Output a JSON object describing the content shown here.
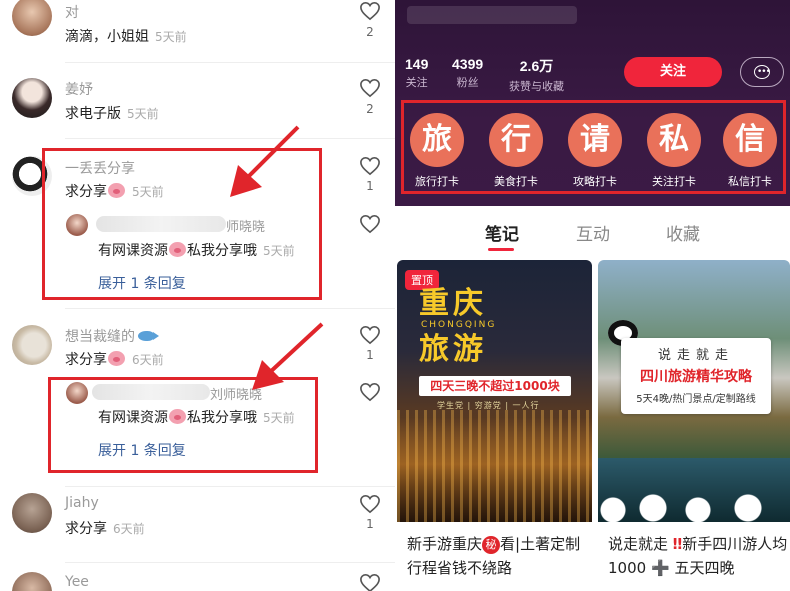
{
  "comments": [
    {
      "user": "对",
      "text": "滴滴，小姐姐",
      "time": "5天前",
      "likes": "2"
    },
    {
      "user": "姜妤",
      "text": "求电子版",
      "time": "5天前",
      "likes": "2"
    },
    {
      "user": "一丢丢分享",
      "text": "求分享",
      "time": "5天前",
      "likes": "1",
      "reply": {
        "name": "师晓晓",
        "text_a": "有网课资源",
        "text_b": "私我分享哦",
        "time": "5天前"
      },
      "expand": "展开 1 条回复"
    },
    {
      "user": "想当裁缝的",
      "text": "求分享",
      "time": "6天前",
      "likes": "1",
      "reply": {
        "name": "刘师晓晓",
        "text_a": "有网课资源",
        "text_b": "私我分享哦",
        "time": "5天前"
      },
      "expand": "展开 1 条回复"
    },
    {
      "user": "Jiahy",
      "text": "求分享",
      "time": "6天前",
      "likes": "1"
    },
    {
      "user": "Yee"
    }
  ],
  "profile": {
    "stats": [
      {
        "num": "149",
        "label": "关注"
      },
      {
        "num": "4399",
        "label": "粉丝"
      },
      {
        "num": "2.6万",
        "label": "获赞与收藏"
      }
    ],
    "follow_label": "关注",
    "categories": [
      {
        "char": "旅",
        "label": "旅行打卡"
      },
      {
        "char": "行",
        "label": "美食打卡"
      },
      {
        "char": "请",
        "label": "攻略打卡"
      },
      {
        "char": "私",
        "label": "关注打卡"
      },
      {
        "char": "信",
        "label": "私信打卡"
      }
    ],
    "tabs": [
      "笔记",
      "互动",
      "收藏"
    ]
  },
  "notes": [
    {
      "pin": "置顶",
      "cover_title_1": "重庆",
      "cover_title_2": "旅游",
      "cover_sub": "CHONGQING",
      "cover_banner": "四天三晚不超过1000块",
      "cover_mini": "学生党 | 穷游党 | 一人行",
      "title_a": "新手游重庆",
      "title_secret": "秘",
      "title_b": "看|土著定制行程省钱不绕路"
    },
    {
      "cover_t1": "说走就走",
      "cover_t2": "四川旅游精华攻略",
      "cover_t3": "5天4晚/热门景点/定制路线",
      "title_a": "说走就走",
      "title_bang": "‼",
      "title_b": "新手四川游人均1000",
      "title_plus": "➕",
      "title_c": "五天四晚"
    }
  ],
  "colors": {
    "accent": "#f0253b",
    "annotation": "#e0252b",
    "category_circle": "#e9715a",
    "header_bg": "#3a1a44"
  }
}
